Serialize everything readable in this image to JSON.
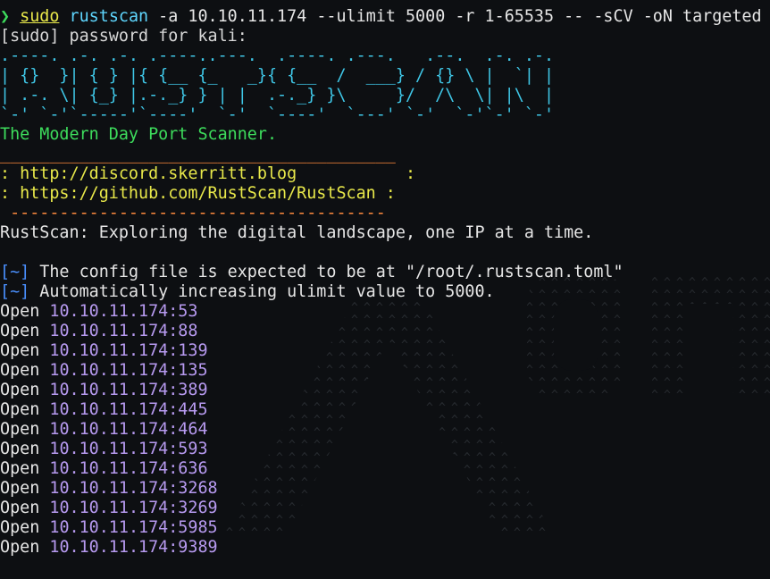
{
  "prompt": {
    "symbol": "❯",
    "cmd": "sudo",
    "program": "rustscan",
    "args": " -a 10.10.11.174 --ulimit 5000 -r 1-65535 -- -sCV -oN targeted"
  },
  "sudo_prompt": "[sudo] password for kali:",
  "banner": [
    ".----. .-. .-. .----..---.  .----. .---.   .--.  .-. .-.",
    "| {}  }| { } |{ {__ {_   _}{ {__  /  ___} / {} \\ |  `| |",
    "| .-. \\| {_} |.-._} } | |  .-._} }\\     }/  /\\  \\| |\\  |",
    "`-' `-'`-----'`----'  `-'  `----'  `---' `-'  `-'`-' `-'"
  ],
  "tagline": "The Modern Day Port Scanner.",
  "links_border_top": "________________________________________",
  "links": [
    ": http://discord.skerritt.blog           :",
    ": https://github.com/RustScan/RustScan :"
  ],
  "links_border_bottom": " --------------------------------------",
  "motto": "RustScan: Exploring the digital landscape, one IP at a time.",
  "info": [
    {
      "tag": "[~]",
      "text": " The config file is expected to be at \"/root/.rustscan.toml\""
    },
    {
      "tag": "[~]",
      "text": " Automatically increasing ulimit value to 5000."
    }
  ],
  "open_label": "Open",
  "ports": [
    "10.10.11.174:53",
    "10.10.11.174:88",
    "10.10.11.174:139",
    "10.10.11.174:135",
    "10.10.11.174:389",
    "10.10.11.174:445",
    "10.10.11.174:464",
    "10.10.11.174:593",
    "10.10.11.174:636",
    "10.10.11.174:3268",
    "10.10.11.174:3269",
    "10.10.11.174:5985",
    "10.10.11.174:9389"
  ],
  "colors": {
    "background": "#0d0f12",
    "prompt_symbol": "#3ddc5c",
    "banner": "#3fc6e6",
    "tagline": "#3ddc5c",
    "links": "#e8e84a",
    "ip_port": "#b79af0",
    "info_tag": "#4a90ff"
  }
}
